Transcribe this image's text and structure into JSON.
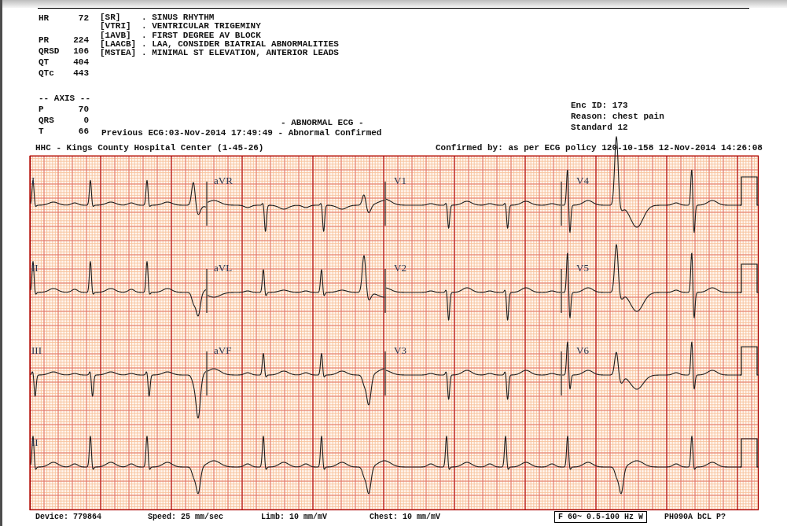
{
  "measurements": [
    {
      "label": "HR",
      "value": "72"
    },
    {
      "label": "PR",
      "value": "224"
    },
    {
      "label": "QRSD",
      "value": "106"
    },
    {
      "label": "QT",
      "value": "404"
    },
    {
      "label": "QTc",
      "value": "443"
    }
  ],
  "interpretation": [
    {
      "code": "[SR]",
      "statement": ". SINUS RHYTHM"
    },
    {
      "code": "[VTRI]",
      "statement": ". VENTRICULAR TRIGEMINY"
    },
    {
      "code": "[1AVB]",
      "statement": ". FIRST DEGREE AV BLOCK"
    },
    {
      "code": "[LAACB]",
      "statement": ". LAA, CONSIDER BIATRIAL ABNORMALITIES"
    },
    {
      "code": "[MSTEA]",
      "statement": ". MINIMAL ST ELEVATION, ANTERIOR LEADS"
    }
  ],
  "axis": {
    "title": "-- AXIS --",
    "items": [
      {
        "label": "P",
        "value": "70"
      },
      {
        "label": "QRS",
        "value": "0"
      },
      {
        "label": "T",
        "value": "66"
      }
    ]
  },
  "summary": "- ABNORMAL ECG -",
  "previous_ecg": "Previous ECG:03-Nov-2014 17:49:49 - Abnormal Confirmed",
  "encounter": [
    "Enc ID: 173",
    "Reason: chest pain",
    "Standard 12"
  ],
  "institution": "HHC - Kings County Hospital Center (1-45-26)",
  "confirmed_by": "Confirmed by: as per ECG policy 120-10-158 12-Nov-2014 14:26:08",
  "lead_rows": [
    [
      "I",
      "aVR",
      "V1",
      "V4"
    ],
    [
      "II",
      "aVL",
      "V2",
      "V5"
    ],
    [
      "III",
      "aVF",
      "V3",
      "V6"
    ],
    [
      "II"
    ]
  ],
  "footer": {
    "device": "Device: 779864",
    "speed": "Speed: 25 mm/sec",
    "limb": "Limb: 10 mm/mV",
    "chest": "Chest: 10 mm/mV",
    "filter": "F 60~ 0.5-100 Hz W",
    "code": "PH090A bCL P?"
  }
}
